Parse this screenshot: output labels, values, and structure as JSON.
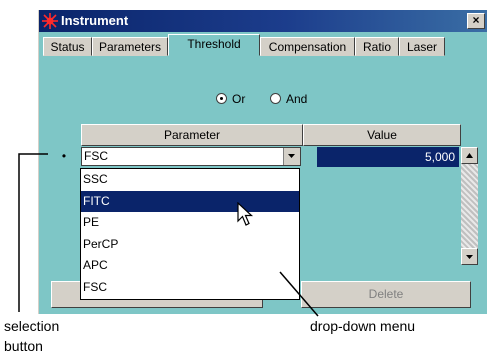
{
  "window": {
    "title": "Instrument",
    "close_label": "×"
  },
  "tabs": [
    {
      "label": "Status",
      "active": false
    },
    {
      "label": "Parameters",
      "active": false
    },
    {
      "label": "Threshold",
      "active": true
    },
    {
      "label": "Compensation",
      "active": false
    },
    {
      "label": "Ratio",
      "active": false
    },
    {
      "label": "Laser",
      "active": false
    }
  ],
  "logic": {
    "options": [
      {
        "label": "Or",
        "selected": true
      },
      {
        "label": "And",
        "selected": false
      }
    ]
  },
  "grid": {
    "columns": [
      "Parameter",
      "Value"
    ],
    "row_selector": "•",
    "row": {
      "parameter": "FSC",
      "value": "5,000"
    }
  },
  "dropdown": {
    "items": [
      "SSC",
      "FITC",
      "PE",
      "PerCP",
      "APC",
      "FSC"
    ],
    "highlighted": "FITC"
  },
  "buttons": {
    "delete_label": "Delete"
  },
  "annotations": {
    "selection_button_line1": "selection",
    "selection_button_line2": "button",
    "dropdown_menu": "drop-down menu"
  },
  "colors": {
    "panel": "#7ec6c6",
    "titlebar": "#0a246a",
    "selection": "#0a246a",
    "face": "#d4d0c8"
  }
}
